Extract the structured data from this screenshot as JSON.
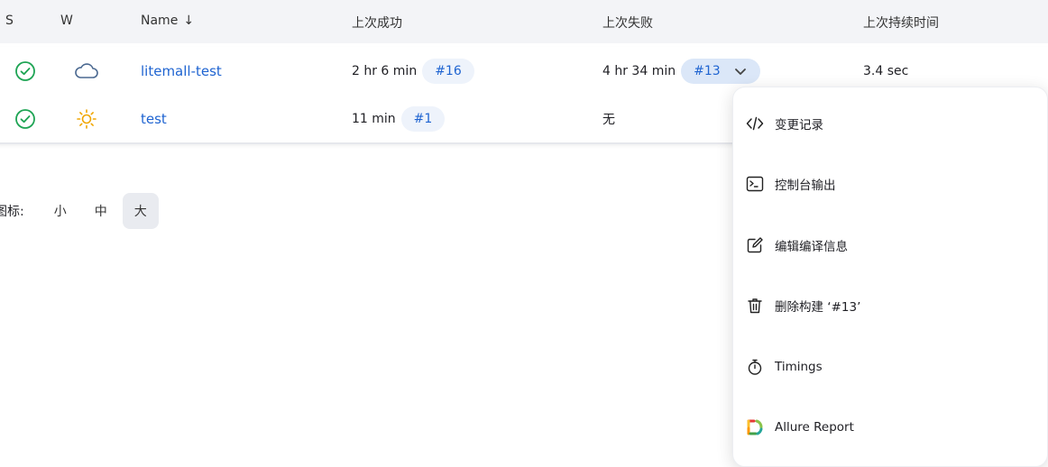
{
  "table": {
    "headers": {
      "status": "S",
      "weather": "W",
      "name": "Name",
      "sort_arrow": "↓",
      "last_success": "上次成功",
      "last_failure": "上次失败",
      "last_duration": "上次持续时间"
    },
    "rows": [
      {
        "name": "litemall-test",
        "last_success_time": "2 hr 6 min",
        "last_success_build": "#16",
        "last_failure_time": "4 hr 34 min",
        "last_failure_build": "#13",
        "last_duration": "3.4 sec",
        "status_icon": "success-check-icon",
        "weather_icon": "cloud-icon"
      },
      {
        "name": "test",
        "last_success_time": "11 min",
        "last_success_build": "#1",
        "last_failure_text": "无",
        "status_icon": "success-check-icon",
        "weather_icon": "sun-icon"
      }
    ]
  },
  "icon_size": {
    "label": "图标:",
    "options": [
      "小",
      "中",
      "大"
    ],
    "selected": "大"
  },
  "dropdown": {
    "items": [
      {
        "label": "变更记录",
        "icon": "code-icon"
      },
      {
        "label": "控制台输出",
        "icon": "terminal-icon"
      },
      {
        "label": "编辑编译信息",
        "icon": "edit-icon"
      },
      {
        "label": "删除构建 ‘#13’",
        "icon": "trash-icon"
      },
      {
        "label": "Timings",
        "icon": "stopwatch-icon"
      },
      {
        "label": "Allure Report",
        "icon": "allure-icon"
      }
    ]
  },
  "colors": {
    "link": "#1f64d1",
    "success": "#1ea454",
    "sun": "#f0a500",
    "cloud": "#4a6890"
  }
}
